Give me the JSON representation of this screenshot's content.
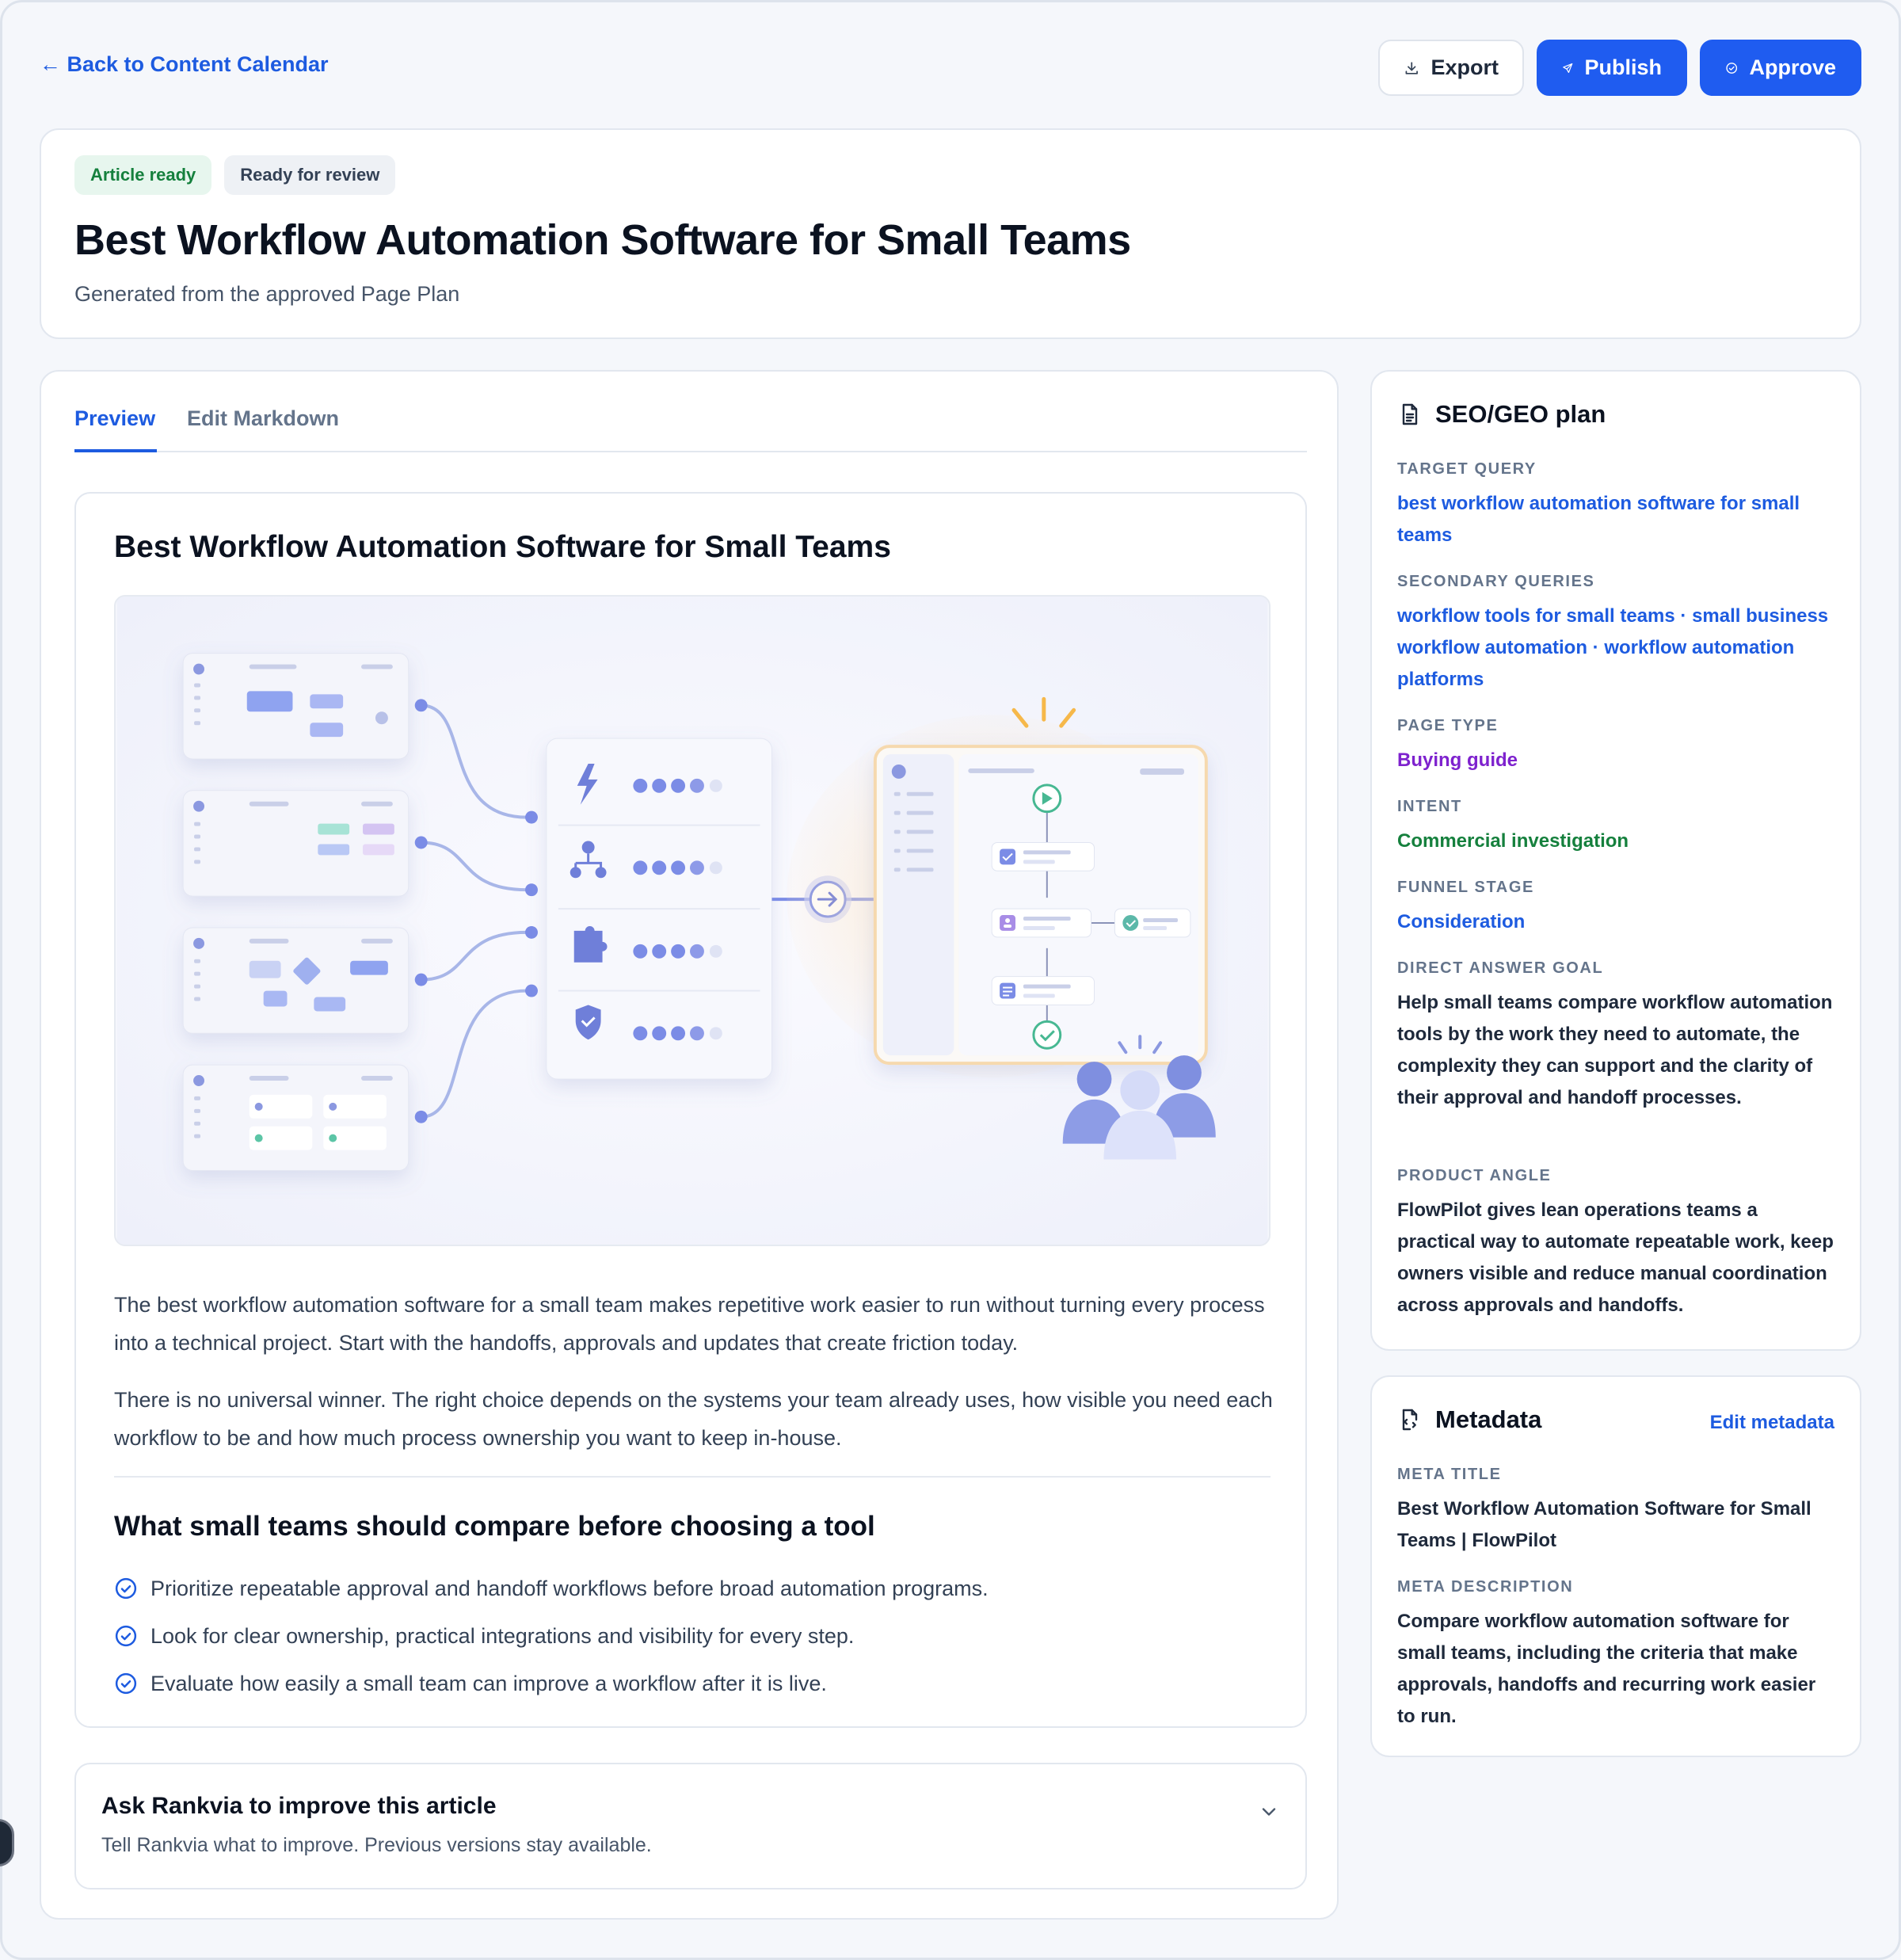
{
  "nav": {
    "back_label": "← Back to Content Calendar"
  },
  "actions": {
    "export_label": "Export",
    "publish_label": "Publish",
    "approve_label": "Approve"
  },
  "header": {
    "badges": [
      "Article ready",
      "Ready for review"
    ],
    "title": "Best Workflow Automation Software for Small Teams",
    "subtitle": "Generated from the approved Page Plan"
  },
  "tabs": [
    {
      "label": "Preview",
      "active": true
    },
    {
      "label": "Edit Markdown",
      "active": false
    }
  ],
  "article": {
    "title": "Best Workflow Automation Software for Small Teams",
    "paragraphs": [
      "The best workflow automation software for a small team makes repetitive work easier to run without turning every process into a technical project. Start with the handoffs, approvals and updates that create friction today.",
      "There is no universal winner. The right choice depends on the systems your team already uses, how visible you need each workflow to be and how much process ownership you want to keep in-house."
    ],
    "section_heading": "What small teams should compare before choosing a tool",
    "checklist": [
      "Prioritize repeatable approval and handoff workflows before broad automation programs.",
      "Look for clear ownership, practical integrations and visibility for every step.",
      "Evaluate how easily a small team can improve a workflow after it is live."
    ]
  },
  "assistant": {
    "title": "Ask Rankvia to improve this article",
    "subtitle": "Tell Rankvia what to improve. Previous versions stay available."
  },
  "seo_plan": {
    "heading": "SEO/GEO plan",
    "fields": [
      {
        "label": "TARGET QUERY",
        "value": "best workflow automation software for small teams",
        "tone": "blue"
      },
      {
        "label": "SECONDARY QUERIES",
        "value": "workflow tools for small teams · small business workflow automation · workflow automation platforms",
        "tone": "blue"
      },
      {
        "label": "PAGE TYPE",
        "value": "Buying guide",
        "tone": "purple"
      },
      {
        "label": "INTENT",
        "value": "Commercial investigation",
        "tone": "green"
      },
      {
        "label": "FUNNEL STAGE",
        "value": "Consideration",
        "tone": "blue"
      },
      {
        "label": "DIRECT ANSWER GOAL",
        "value": "Help small teams compare workflow automation tools by the work they need to automate, the complexity they can support and the clarity of their approval and handoff processes.",
        "tone": "dark"
      },
      {
        "label": "PRODUCT ANGLE",
        "value": "FlowPilot gives lean operations teams a practical way to automate repeatable work, keep owners visible and reduce manual coordination across approvals and handoffs.",
        "tone": "dark"
      }
    ]
  },
  "metadata": {
    "heading": "Metadata",
    "edit_label": "Edit metadata",
    "fields": [
      {
        "label": "META TITLE",
        "value": "Best Workflow Automation Software for Small Teams | FlowPilot"
      },
      {
        "label": "META DESCRIPTION",
        "value": "Compare workflow automation software for small teams, including the criteria that make approvals, handoffs and recurring work easier to run."
      }
    ]
  },
  "colors": {
    "accent": "#1d5be0",
    "primary_button": "#1f5cf0",
    "badge_green_bg": "#e7f6ee",
    "badge_green_text": "#15803d",
    "purple": "#7e22ce",
    "green": "#15803d"
  },
  "icons": [
    "arrow-left-icon",
    "download-icon",
    "send-icon",
    "check-circle-icon",
    "document-icon",
    "metadata-file-icon",
    "chevron-down-icon",
    "checklist-check-icon"
  ]
}
